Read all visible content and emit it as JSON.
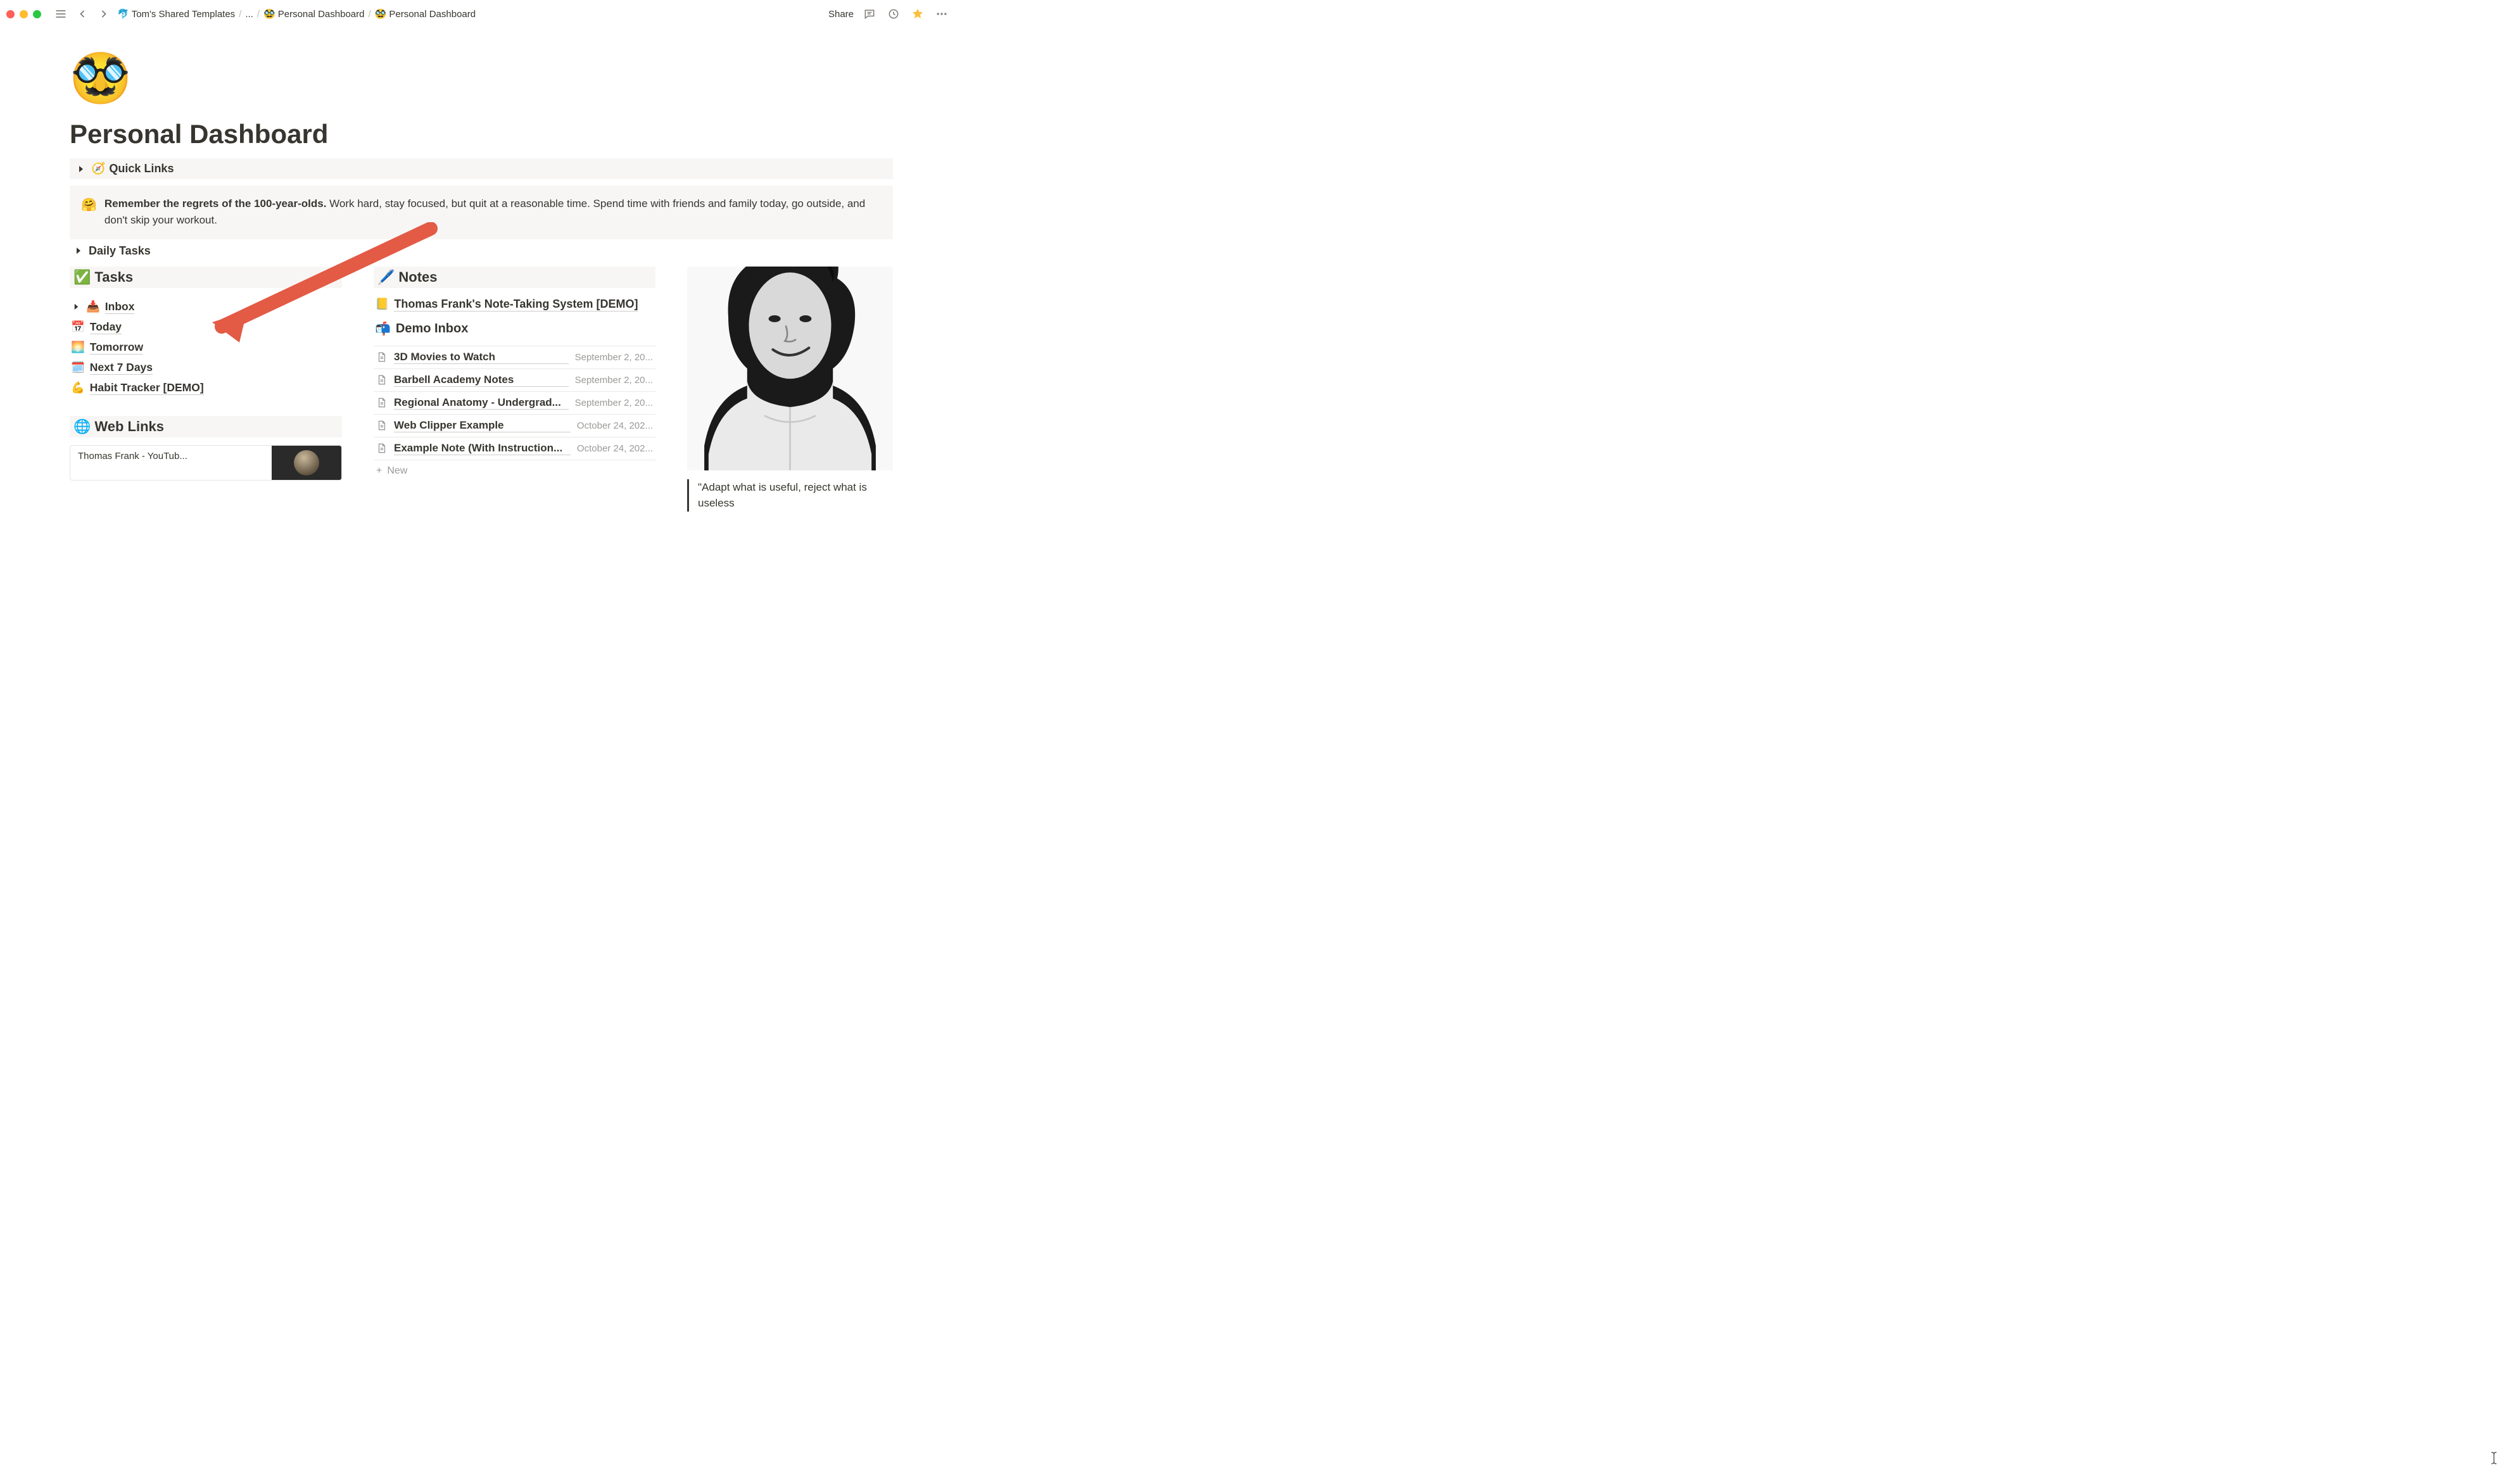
{
  "breadcrumbs": {
    "items": [
      {
        "icon": "🐬",
        "label": "Tom's Shared Templates"
      },
      {
        "icon": "",
        "label": "..."
      },
      {
        "icon": "🥸",
        "label": "Personal Dashboard"
      },
      {
        "icon": "🥸",
        "label": "Personal Dashboard"
      }
    ]
  },
  "topbar": {
    "share": "Share"
  },
  "page": {
    "emoji": "🥸",
    "title": "Personal Dashboard"
  },
  "quicklinks": {
    "icon": "🧭",
    "label": "Quick Links"
  },
  "callout": {
    "emoji": "🤗",
    "bold": "Remember the regrets of the 100-year-olds.",
    "rest": " Work hard, stay focused, but quit at a reasonable time. Spend time with friends and family today, go outside, and don't skip your workout."
  },
  "daily": {
    "label": "Daily Tasks"
  },
  "tasks": {
    "header_icon": "✅",
    "header": "Tasks",
    "items": [
      {
        "icon": "📥",
        "label": "Inbox",
        "hasToggle": true
      },
      {
        "icon": "📅",
        "label": "Today"
      },
      {
        "icon": "🌅",
        "label": "Tomorrow"
      },
      {
        "icon": "🗓️",
        "label": "Next 7 Days"
      },
      {
        "icon": "💪",
        "label": "Habit Tracker [DEMO]"
      }
    ]
  },
  "weblinks": {
    "header_icon": "🌐",
    "header": "Web Links",
    "card_title": "Thomas Frank - YouTub..."
  },
  "notes": {
    "header_icon": "🖊️",
    "header": "Notes",
    "system_icon": "📒",
    "system_label": "Thomas Frank's Note-Taking System [DEMO]",
    "inbox_icon": "📬",
    "inbox_label": "Demo Inbox",
    "rows": [
      {
        "title": "3D Movies to Watch",
        "date": "September 2, 20..."
      },
      {
        "title": "Barbell Academy Notes",
        "date": "September 2, 20..."
      },
      {
        "title": "Regional Anatomy - Undergrad...",
        "date": "September 2, 20..."
      },
      {
        "title": "Web Clipper Example",
        "date": "October 24, 202..."
      },
      {
        "title": "Example Note (With Instruction...",
        "date": "October 24, 202..."
      }
    ],
    "new_label": "New"
  },
  "quote": {
    "text": "\"Adapt what is useful, reject what is useless"
  }
}
